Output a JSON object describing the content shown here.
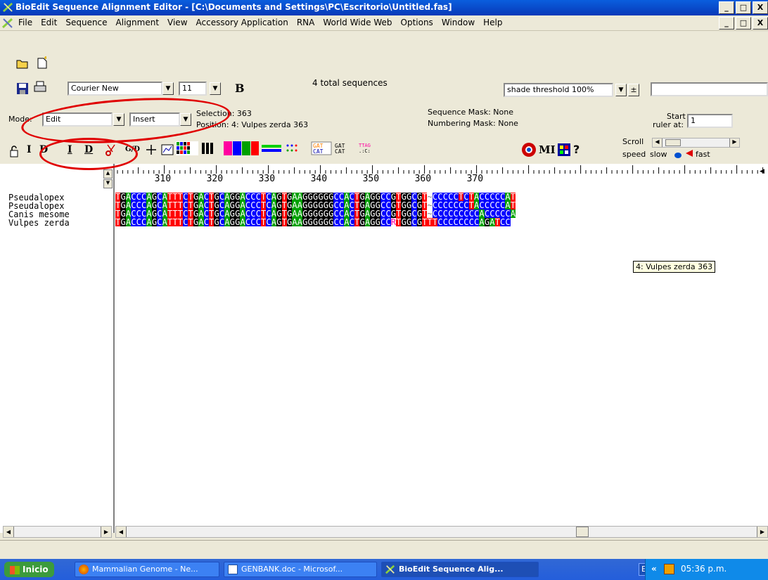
{
  "window": {
    "title": "BioEdit Sequence Alignment Editor - [C:\\Documents and Settings\\PC\\Escritorio\\Untitled.fas]",
    "min_label": "_",
    "max_label": " □",
    "close_label": "X"
  },
  "menu": {
    "items": [
      "File",
      "Edit",
      "Sequence",
      "Alignment",
      "View",
      "Accessory Application",
      "RNA",
      "World Wide Web",
      "Options",
      "Window",
      "Help"
    ]
  },
  "toolbar": {
    "font_name": "Courier New",
    "font_size": "11",
    "bold_label": "B",
    "sequence_count": "4 total sequences",
    "shade_threshold": "shade threshold 100%",
    "mode_label": "Mode:",
    "mode_value": "Edit",
    "insert_value": "Insert",
    "selection": "Selection: 363",
    "position": "Position:  4: Vulpes zerda 363",
    "sequence_mask": "Sequence Mask: None",
    "numbering_mask": "Numbering Mask: None",
    "start_label": "Start",
    "ruler_label": "ruler at:",
    "ruler_value": "1",
    "scroll_label": "Scroll",
    "speed_label": "speed",
    "slow_label": "slow",
    "fast_label": "fast",
    "mi_label": "MI",
    "lock_icon": "lock-icon",
    "i_label": "I",
    "d_label": "D",
    "gd_label": "G/D",
    "ti_label": "I",
    "td_label": "D"
  },
  "ruler": {
    "ticks": [
      "310",
      "320",
      "330",
      "340",
      "350",
      "360",
      "370"
    ]
  },
  "sequences": [
    {
      "name": "Pseudalopex",
      "seq": "TGACCCAGCATTTCTGACTGCAGGACCCTCAGTGAAGGGGGGCCACTGAGGCCGTGGCGT~CCCCCTCTACCCCCAT"
    },
    {
      "name": "Pseudalopex",
      "seq": "TGACCCAGCATTTCTGACTGCAGGACCCTCAGTGAAGGGGGGCCACTGAGGCCGTGGCGT~CCCCCCCTACCCCCAT"
    },
    {
      "name": "Canis mesome",
      "seq": "TGACCCAGCATTTCTGACTGCAGGACCCTCAGTGAAGGGGGGCCACTGAGGCCGTGGCGT~CCCCCCCCCACCCCCA"
    },
    {
      "name": "Vulpes zerda",
      "seq": "TGACCCAGCATTTCTGACTGCAGGACCCTCAGTGAAGGGGGGCCACTGAGGCCRTGGCGTTTCCCCCCCCAGATCC"
    }
  ],
  "tooltip": "4: Vulpes zerda 363",
  "taskbar": {
    "start": "Inicio",
    "tasks": [
      "Mammalian Genome - Ne...",
      "GENBANK.doc - Microsof...",
      "BioEdit Sequence Alig..."
    ],
    "lang": "ES",
    "chevron": "«",
    "time": "05:36 p.m."
  },
  "colors": {
    "A": "#00a000",
    "C": "#0000ff",
    "G": "#000000",
    "T": "#ff0000",
    "annotation": "#e00000"
  }
}
